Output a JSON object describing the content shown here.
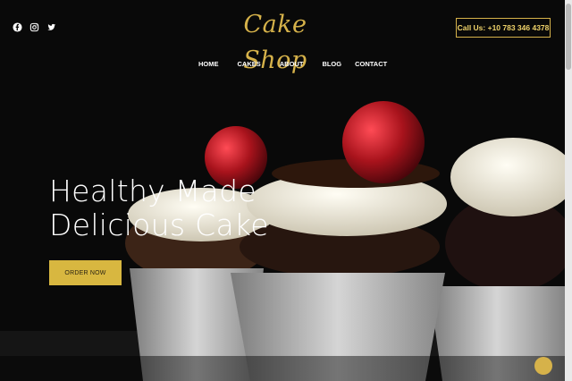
{
  "brand": {
    "name": "Cake Shop"
  },
  "header": {
    "social_icons": [
      "facebook-icon",
      "instagram-icon",
      "twitter-icon"
    ],
    "call_label": "Call Us: +10 783 346 4378"
  },
  "nav": {
    "items": [
      "HOME",
      "CAKES",
      "ABOUT",
      "BLOG",
      "CONTACT"
    ]
  },
  "hero": {
    "headline_line1": "Healthy Made",
    "headline_line2": "Delicious Cake",
    "cta_label": "ORDER NOW"
  },
  "colors": {
    "accent": "#d6b24a",
    "button": "#d8b740",
    "background": "#090909"
  }
}
